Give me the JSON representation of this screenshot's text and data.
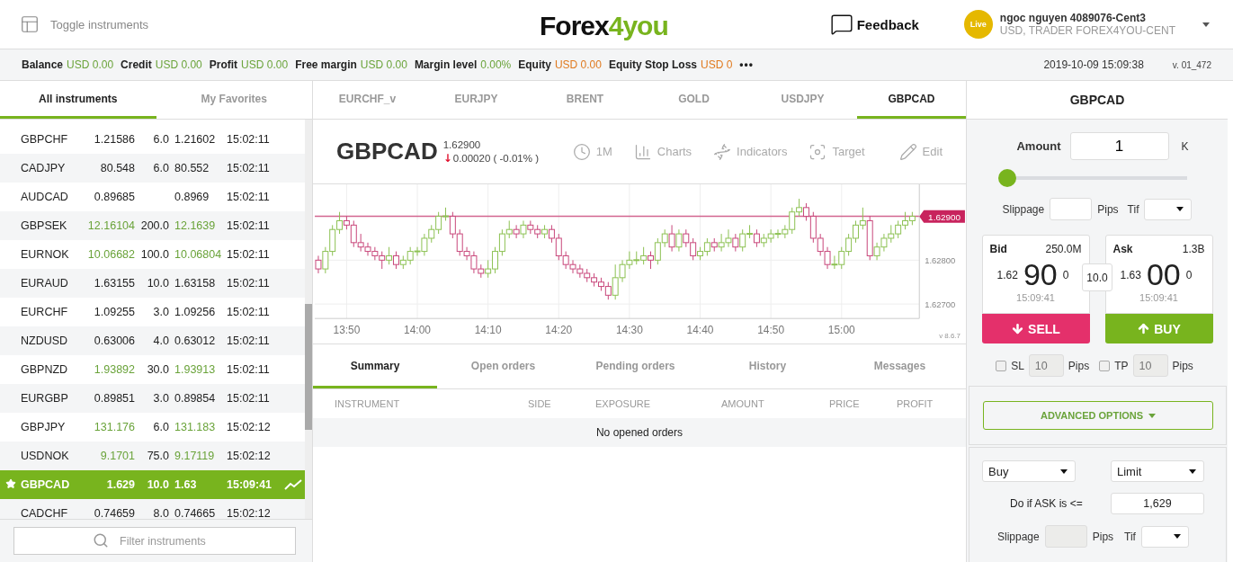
{
  "header": {
    "toggle_label": "Toggle instruments",
    "logo": {
      "main": "Forex",
      "accent": "4you"
    },
    "feedback": "Feedback",
    "account": {
      "badge": "Live",
      "name": "ngoc nguyen 4089076-Cent3",
      "details": "USD, TRADER FOREX4YOU-CENT"
    }
  },
  "account_bar": {
    "items": [
      {
        "label": "Balance",
        "value": "USD 0.00",
        "color": "#6aa33a"
      },
      {
        "label": "Credit",
        "value": "USD 0.00",
        "color": "#6aa33a"
      },
      {
        "label": "Profit",
        "value": "USD 0.00",
        "color": "#6aa33a"
      },
      {
        "label": "Free margin",
        "value": "USD 0.00",
        "color": "#6aa33a"
      },
      {
        "label": "Margin level",
        "value": "0.00%",
        "color": "#6aa33a"
      },
      {
        "label": "Equity",
        "value": "USD 0.00",
        "color": "#e07a1f"
      },
      {
        "label": "Equity Stop Loss",
        "value": "USD 0",
        "color": "#e07a1f"
      }
    ],
    "more": "•••",
    "datetime": "2019-10-09 15:09:38",
    "version": "v. 01_472"
  },
  "instruments": {
    "tabs": [
      {
        "label": "All instruments",
        "selected": true
      },
      {
        "label": "My Favorites",
        "selected": false
      }
    ],
    "rows": [
      {
        "symbol": "GBPCHF",
        "bid": "1.21586",
        "spread": "6.0",
        "ask": "1.21602",
        "time": "15:02:11",
        "color": "#222222",
        "selected": false
      },
      {
        "symbol": "CADJPY",
        "bid": "80.548",
        "spread": "6.0",
        "ask": "80.552",
        "time": "15:02:11",
        "color": "#222222",
        "selected": false
      },
      {
        "symbol": "AUDCAD",
        "bid": "0.89685",
        "ask": "0.8969",
        "time": "15:02:11",
        "color": "#222222",
        "selected": false
      },
      {
        "symbol": "GBPSEK",
        "bid": "12.16104",
        "spread": "200.0",
        "ask": "12.1639",
        "time": "15:02:11",
        "color": "#6aa33a",
        "selected": false
      },
      {
        "symbol": "EURNOK",
        "bid": "10.06682",
        "spread": "100.0",
        "ask": "10.06804",
        "time": "15:02:11",
        "color": "#6aa33a",
        "selected": false
      },
      {
        "symbol": "EURAUD",
        "bid": "1.63155",
        "spread": "10.0",
        "ask": "1.63158",
        "time": "15:02:11",
        "color": "#222222",
        "selected": false
      },
      {
        "symbol": "EURCHF",
        "bid": "1.09255",
        "spread": "3.0",
        "ask": "1.09256",
        "time": "15:02:11",
        "color": "#222222",
        "selected": false
      },
      {
        "symbol": "NZDUSD",
        "bid": "0.63006",
        "spread": "4.0",
        "ask": "0.63012",
        "time": "15:02:11",
        "color": "#222222",
        "selected": false
      },
      {
        "symbol": "GBPNZD",
        "bid": "1.93892",
        "spread": "30.0",
        "ask": "1.93913",
        "time": "15:02:11",
        "color": "#6aa33a",
        "selected": false
      },
      {
        "symbol": "EURGBP",
        "bid": "0.89851",
        "spread": "3.0",
        "ask": "0.89854",
        "time": "15:02:11",
        "color": "#222222",
        "selected": false
      },
      {
        "symbol": "GBPJPY",
        "bid": "131.176",
        "spread": "6.0",
        "ask": "131.183",
        "time": "15:02:12",
        "color": "#6aa33a",
        "selected": false
      },
      {
        "symbol": "USDNOK",
        "bid": "9.1701",
        "spread": "75.0",
        "ask": "9.17119",
        "time": "15:02:12",
        "color": "#6aa33a",
        "selected": false
      },
      {
        "symbol": "GBPCAD",
        "bid": "1.629",
        "spread": "10.0",
        "ask": "1.63",
        "time": "15:09:41",
        "color": "#ffffff",
        "selected": true
      },
      {
        "symbol": "CADCHF",
        "bid": "0.74659",
        "spread": "8.0",
        "ask": "0.74665",
        "time": "15:02:12",
        "color": "#222222",
        "selected": false
      }
    ],
    "filter": {
      "placeholder": "Filter instruments"
    }
  },
  "chart_tabs": [
    {
      "label": "EURCHF_v",
      "selected": false
    },
    {
      "label": "EURJPY",
      "selected": false
    },
    {
      "label": "BRENT",
      "selected": false
    },
    {
      "label": "GOLD",
      "selected": false
    },
    {
      "label": "USDJPY",
      "selected": false
    },
    {
      "label": "GBPCAD",
      "selected": true
    }
  ],
  "quote": {
    "symbol": "GBPCAD",
    "price": "1.62900",
    "arrow": "↓",
    "change": "0.00020 ( -0.01% )"
  },
  "chart_tools": [
    {
      "kind": "clock",
      "label": "1M"
    },
    {
      "kind": "charts",
      "label": "Charts"
    },
    {
      "kind": "indicators",
      "label": "Indicators"
    },
    {
      "kind": "target",
      "label": "Target"
    },
    {
      "kind": "edit",
      "label": "Edit"
    }
  ],
  "chart": {
    "current_price": "1.62900",
    "version": "v 8.6.7",
    "chart_data": {
      "type": "candlestick",
      "ylim": [
        1.62667,
        1.62973
      ],
      "grid": true,
      "ref_lines": [
        {
          "axis": "y",
          "value": 1.629,
          "color": "#d2658f"
        }
      ],
      "yticks": [
        {
          "value": 1.628,
          "label": "1.62800"
        },
        {
          "value": 1.627,
          "label": "1.62700"
        }
      ],
      "categories": [
        null,
        null,
        null,
        null,
        "13:50",
        null,
        null,
        null,
        null,
        null,
        null,
        null,
        null,
        null,
        "14:00",
        null,
        null,
        null,
        null,
        null,
        null,
        null,
        null,
        null,
        "14:10",
        null,
        null,
        null,
        null,
        null,
        null,
        null,
        null,
        null,
        "14:20",
        null,
        null,
        null,
        null,
        null,
        null,
        null,
        null,
        null,
        "14:30",
        null,
        null,
        null,
        null,
        null,
        null,
        null,
        null,
        null,
        "14:40",
        null,
        null,
        null,
        null,
        null,
        null,
        null,
        null,
        null,
        "14:50",
        null,
        null,
        null,
        null,
        null,
        null,
        null,
        null,
        null,
        "15:00",
        null,
        null,
        null,
        null,
        null,
        null,
        null,
        null,
        null,
        null
      ],
      "ohlc": [
        [
          1.628,
          1.6281,
          1.6277,
          1.6278
        ],
        [
          1.6278,
          1.6283,
          1.6277,
          1.6282
        ],
        [
          1.6282,
          1.6288,
          1.6281,
          1.6287
        ],
        [
          1.6287,
          1.6291,
          1.6286,
          1.6289
        ],
        [
          1.6289,
          1.629,
          1.6287,
          1.6288
        ],
        [
          1.6288,
          1.6289,
          1.6283,
          1.6284
        ],
        [
          1.6284,
          1.6286,
          1.6282,
          1.6283
        ],
        [
          1.6283,
          1.6284,
          1.6281,
          1.6282
        ],
        [
          1.6282,
          1.6283,
          1.628,
          1.6281
        ],
        [
          1.6281,
          1.6282,
          1.6278,
          1.628
        ],
        [
          1.628,
          1.6283,
          1.6279,
          1.6281
        ],
        [
          1.6281,
          1.6282,
          1.6278,
          1.6279
        ],
        [
          1.6279,
          1.6281,
          1.6278,
          1.628
        ],
        [
          1.628,
          1.6283,
          1.6279,
          1.6282
        ],
        [
          1.6282,
          1.6283,
          1.6281,
          1.6282
        ],
        [
          1.6282,
          1.6286,
          1.6281,
          1.6285
        ],
        [
          1.6285,
          1.6288,
          1.6284,
          1.6287
        ],
        [
          1.6287,
          1.6291,
          1.6286,
          1.629
        ],
        [
          1.629,
          1.6292,
          1.6289,
          1.629
        ],
        [
          1.629,
          1.6291,
          1.6285,
          1.6286
        ],
        [
          1.6286,
          1.6287,
          1.6281,
          1.6282
        ],
        [
          1.6282,
          1.6283,
          1.628,
          1.6281
        ],
        [
          1.6281,
          1.6282,
          1.6277,
          1.6278
        ],
        [
          1.6278,
          1.6279,
          1.6276,
          1.6277
        ],
        [
          1.6277,
          1.628,
          1.6276,
          1.6278
        ],
        [
          1.6278,
          1.6283,
          1.6277,
          1.6282
        ],
        [
          1.6282,
          1.6287,
          1.6281,
          1.6286
        ],
        [
          1.6286,
          1.6289,
          1.6285,
          1.6287
        ],
        [
          1.6287,
          1.6288,
          1.6285,
          1.6286
        ],
        [
          1.6286,
          1.6289,
          1.6285,
          1.6288
        ],
        [
          1.6288,
          1.6289,
          1.6286,
          1.6287
        ],
        [
          1.6287,
          1.6288,
          1.6285,
          1.6286
        ],
        [
          1.6286,
          1.6288,
          1.6285,
          1.6287
        ],
        [
          1.6287,
          1.6288,
          1.6284,
          1.6285
        ],
        [
          1.6285,
          1.6286,
          1.628,
          1.6281
        ],
        [
          1.6281,
          1.6282,
          1.6278,
          1.6279
        ],
        [
          1.6279,
          1.628,
          1.6277,
          1.6278
        ],
        [
          1.6278,
          1.6279,
          1.6276,
          1.6277
        ],
        [
          1.6277,
          1.6278,
          1.6275,
          1.6276
        ],
        [
          1.6276,
          1.6277,
          1.6274,
          1.6275
        ],
        [
          1.6275,
          1.6276,
          1.6273,
          1.6274
        ],
        [
          1.6274,
          1.6275,
          1.6271,
          1.6272
        ],
        [
          1.6272,
          1.6279,
          1.6271,
          1.6276
        ],
        [
          1.6276,
          1.628,
          1.6275,
          1.6279
        ],
        [
          1.6279,
          1.6282,
          1.6278,
          1.628
        ],
        [
          1.628,
          1.6282,
          1.6279,
          1.628
        ],
        [
          1.628,
          1.6283,
          1.6279,
          1.6281
        ],
        [
          1.6281,
          1.6282,
          1.6278,
          1.628
        ],
        [
          1.628,
          1.6285,
          1.6279,
          1.6284
        ],
        [
          1.6284,
          1.6287,
          1.6283,
          1.6286
        ],
        [
          1.6286,
          1.6288,
          1.6282,
          1.6283
        ],
        [
          1.6283,
          1.6287,
          1.6282,
          1.6286
        ],
        [
          1.6286,
          1.6287,
          1.6283,
          1.6284
        ],
        [
          1.6284,
          1.6285,
          1.628,
          1.6281
        ],
        [
          1.6281,
          1.6283,
          1.628,
          1.6282
        ],
        [
          1.6282,
          1.6285,
          1.6281,
          1.6284
        ],
        [
          1.6284,
          1.6285,
          1.6282,
          1.6283
        ],
        [
          1.6283,
          1.6286,
          1.6282,
          1.6284
        ],
        [
          1.6284,
          1.6287,
          1.6283,
          1.6285
        ],
        [
          1.6285,
          1.6286,
          1.6282,
          1.6283
        ],
        [
          1.6283,
          1.6287,
          1.6282,
          1.6286
        ],
        [
          1.6286,
          1.6288,
          1.6285,
          1.6286
        ],
        [
          1.6286,
          1.6287,
          1.6283,
          1.6284
        ],
        [
          1.6284,
          1.6286,
          1.6283,
          1.6285
        ],
        [
          1.6285,
          1.6287,
          1.6284,
          1.6286
        ],
        [
          1.6286,
          1.6287,
          1.6285,
          1.6286
        ],
        [
          1.6286,
          1.6288,
          1.6285,
          1.6287
        ],
        [
          1.6287,
          1.6292,
          1.6286,
          1.6291
        ],
        [
          1.6291,
          1.6294,
          1.629,
          1.6292
        ],
        [
          1.6292,
          1.6293,
          1.6289,
          1.629
        ],
        [
          1.629,
          1.6291,
          1.6284,
          1.6285
        ],
        [
          1.6285,
          1.6286,
          1.6281,
          1.6282
        ],
        [
          1.6282,
          1.6283,
          1.6278,
          1.6279
        ],
        [
          1.6279,
          1.6281,
          1.6278,
          1.6279
        ],
        [
          1.6279,
          1.6283,
          1.6278,
          1.6282
        ],
        [
          1.6282,
          1.6286,
          1.6281,
          1.6285
        ],
        [
          1.6285,
          1.6289,
          1.6284,
          1.6288
        ],
        [
          1.6288,
          1.6292,
          1.6287,
          1.6289
        ],
        [
          1.6289,
          1.629,
          1.628,
          1.6281
        ],
        [
          1.6281,
          1.6284,
          1.628,
          1.6283
        ],
        [
          1.6283,
          1.6286,
          1.6282,
          1.6285
        ],
        [
          1.6285,
          1.6288,
          1.6284,
          1.6286
        ],
        [
          1.6286,
          1.6289,
          1.6285,
          1.6288
        ],
        [
          1.6288,
          1.6291,
          1.6287,
          1.6289
        ],
        [
          1.6289,
          1.6291,
          1.6288,
          1.629
        ]
      ]
    }
  },
  "orders": {
    "tabs": [
      {
        "label": "Summary",
        "selected": true
      },
      {
        "label": "Open orders",
        "selected": false
      },
      {
        "label": "Pending orders",
        "selected": false
      },
      {
        "label": "History",
        "selected": false
      },
      {
        "label": "Messages",
        "selected": false
      }
    ],
    "columns": [
      "INSTRUMENT",
      "SIDE",
      "EXPOSURE",
      "AMOUNT",
      "PRICE",
      "PROFIT"
    ],
    "empty": "No opened orders"
  },
  "trade": {
    "title": "GBPCAD",
    "amount": {
      "label": "Amount",
      "value": "1",
      "unit": "K",
      "level": 0
    },
    "slippage": {
      "label": "Slippage",
      "unit": "Pips"
    },
    "tif": {
      "label": "Tif"
    },
    "bid": {
      "label": "Bid",
      "volume": "250.0M",
      "prefix": "1.62",
      "big": "90",
      "suffix": "0",
      "time": "15:09:41"
    },
    "spread": "10.0",
    "ask": {
      "label": "Ask",
      "volume": "1.3B",
      "prefix": "1.63",
      "big": "00",
      "suffix": "0",
      "time": "15:09:41"
    },
    "sell": "SELL",
    "buy": "BUY",
    "sl": {
      "label": "SL",
      "placeholder": "10",
      "unit": "Pips",
      "checked": false
    },
    "tp": {
      "label": "TP",
      "placeholder": "10",
      "unit": "Pips",
      "checked": false
    },
    "advanced": "ADVANCED OPTIONS",
    "order": {
      "side": "Buy",
      "type": "Limit",
      "condition_label": "Do if ASK is <=",
      "condition_value": "1,629",
      "slippage_label": "Slippage",
      "slippage_unit": "Pips",
      "tif_label": "Tif"
    }
  }
}
